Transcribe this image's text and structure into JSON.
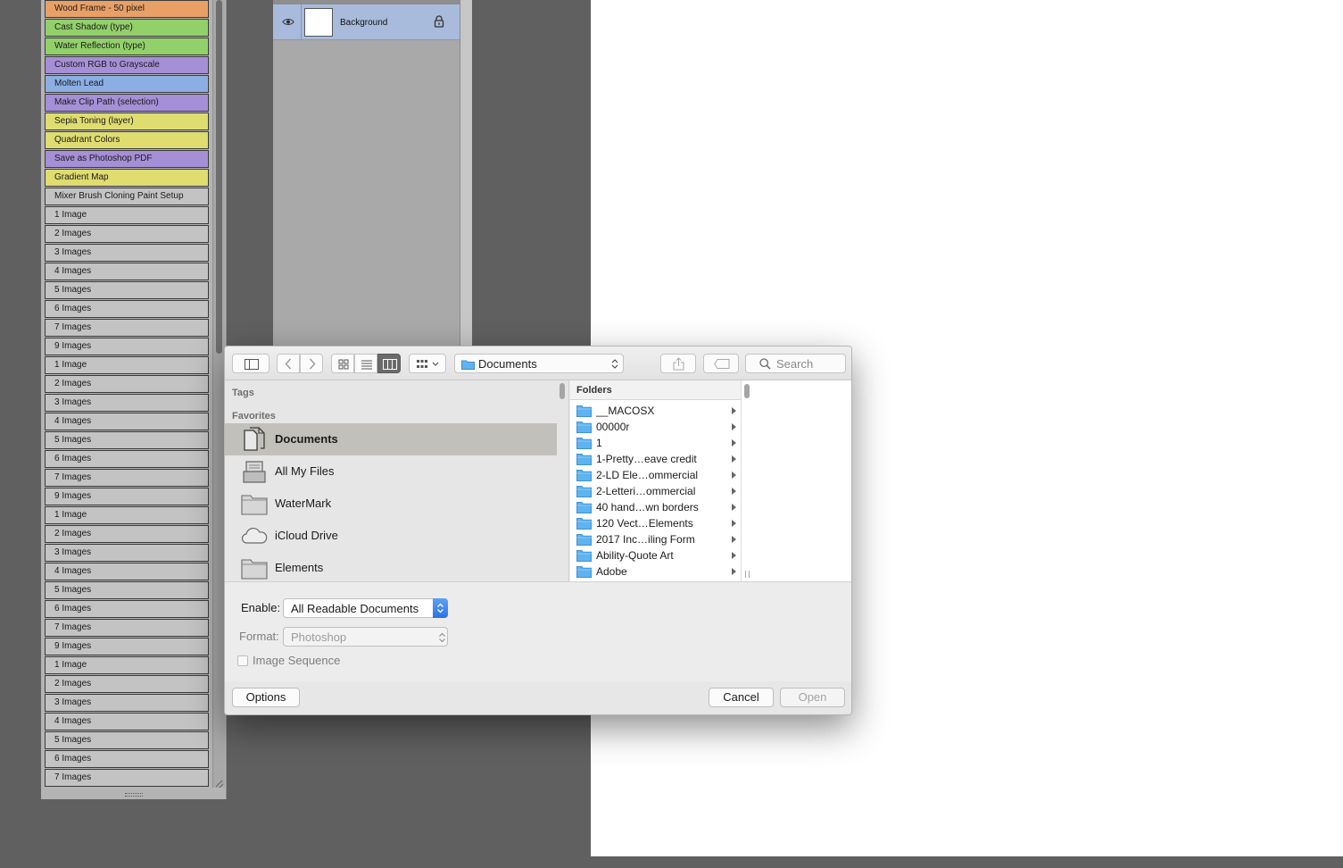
{
  "actions_panel": {
    "items": [
      {
        "label": "Wood Frame - 50 pixel",
        "color": "#e8a066"
      },
      {
        "label": "Cast Shadow (type)",
        "color": "#92d06a"
      },
      {
        "label": "Water Reflection (type)",
        "color": "#92d06a"
      },
      {
        "label": "Custom RGB to Grayscale",
        "color": "#a58fd6"
      },
      {
        "label": "Molten Lead",
        "color": "#8caee3"
      },
      {
        "label": "Make Clip Path (selection)",
        "color": "#a58fd6"
      },
      {
        "label": "Sepia Toning (layer)",
        "color": "#dfdc70"
      },
      {
        "label": "Quadrant Colors",
        "color": "#dfdc70"
      },
      {
        "label": "Save as Photoshop PDF",
        "color": "#a58fd6"
      },
      {
        "label": "Gradient Map",
        "color": "#dfdc70"
      },
      {
        "label": "Mixer Brush Cloning Paint Setup",
        "color": "#c3c3c3"
      },
      {
        "label": "1 Image",
        "color": "#c3c3c3"
      },
      {
        "label": "2 Images",
        "color": "#c3c3c3"
      },
      {
        "label": "3 Images",
        "color": "#c3c3c3"
      },
      {
        "label": "4 Images",
        "color": "#c3c3c3"
      },
      {
        "label": "5 Images",
        "color": "#c3c3c3"
      },
      {
        "label": "6 Images",
        "color": "#c3c3c3"
      },
      {
        "label": "7 Images",
        "color": "#c3c3c3"
      },
      {
        "label": "9 Images",
        "color": "#c3c3c3"
      },
      {
        "label": "1 Image",
        "color": "#c3c3c3"
      },
      {
        "label": "2 Images",
        "color": "#c3c3c3"
      },
      {
        "label": "3 Images",
        "color": "#c3c3c3"
      },
      {
        "label": "4 Images",
        "color": "#c3c3c3"
      },
      {
        "label": "5 Images",
        "color": "#c3c3c3"
      },
      {
        "label": "6 Images",
        "color": "#c3c3c3"
      },
      {
        "label": "7 Images",
        "color": "#c3c3c3"
      },
      {
        "label": "9 Images",
        "color": "#c3c3c3"
      },
      {
        "label": "1 Image",
        "color": "#c3c3c3"
      },
      {
        "label": "2 Images",
        "color": "#c3c3c3"
      },
      {
        "label": "3 Images",
        "color": "#c3c3c3"
      },
      {
        "label": "4 Images",
        "color": "#c3c3c3"
      },
      {
        "label": "5 Images",
        "color": "#c3c3c3"
      },
      {
        "label": "6 Images",
        "color": "#c3c3c3"
      },
      {
        "label": "7 Images",
        "color": "#c3c3c3"
      },
      {
        "label": "9 Images",
        "color": "#c3c3c3"
      },
      {
        "label": "1 Image",
        "color": "#c3c3c3"
      },
      {
        "label": "2 Images",
        "color": "#c3c3c3"
      },
      {
        "label": "3 Images",
        "color": "#c3c3c3"
      },
      {
        "label": "4 Images",
        "color": "#c3c3c3"
      },
      {
        "label": "5 Images",
        "color": "#c3c3c3"
      },
      {
        "label": "6 Images",
        "color": "#c3c3c3"
      },
      {
        "label": "7 Images",
        "color": "#c3c3c3"
      }
    ]
  },
  "layers_panel": {
    "layer_name": "Background"
  },
  "dialog": {
    "location": "Documents",
    "search_placeholder": "Search",
    "sidebar": {
      "tags_heading": "Tags",
      "favorites_heading": "Favorites",
      "items": [
        {
          "label": "Documents",
          "icon": "documents-icon"
        },
        {
          "label": "All My Files",
          "icon": "all-my-files-icon"
        },
        {
          "label": "WaterMark",
          "icon": "folder-icon"
        },
        {
          "label": "iCloud Drive",
          "icon": "icloud-icon"
        },
        {
          "label": "Elements",
          "icon": "folder-icon"
        }
      ]
    },
    "folders_header": "Folders",
    "folders": [
      "__MACOSX",
      "00000r",
      "1",
      "1-Pretty…eave credit",
      "2-LD Ele…ommercial",
      "2-Letteri…ommercial",
      "40 hand…wn borders",
      "120 Vect…Elements",
      "2017 Inc…iling Form",
      "Ability-Quote Art",
      "Adobe"
    ],
    "enable_label": "Enable:",
    "enable_value": "All Readable Documents",
    "format_label": "Format:",
    "format_value": "Photoshop",
    "image_sequence_label": "Image Sequence",
    "options_button": "Options",
    "cancel_button": "Cancel",
    "open_button": "Open"
  },
  "colors": {
    "selection_blue": "#a8bbdc",
    "folder_blue": "#5fb3ee",
    "accent_blue": "#2a72e6"
  }
}
